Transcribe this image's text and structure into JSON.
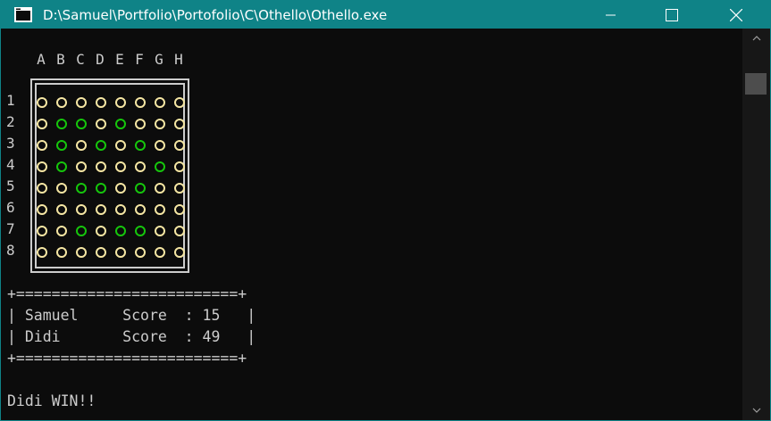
{
  "window": {
    "title": "D:\\Samuel\\Portfolio\\Portofolio\\C\\Othello\\Othello.exe",
    "title_bar_color": "#0f8387",
    "icons": {
      "app": "console-app-icon",
      "minimize": "minimize-icon",
      "maximize": "maximize-icon",
      "close": "close-icon"
    }
  },
  "board": {
    "columns": [
      "A",
      "B",
      "C",
      "D",
      "E",
      "F",
      "G",
      "H"
    ],
    "rows": [
      "1",
      "2",
      "3",
      "4",
      "5",
      "6",
      "7",
      "8"
    ],
    "legend_colors": {
      "Y": "#f5e6a3",
      "G": "#16c60c"
    },
    "grid": [
      [
        "Y",
        "Y",
        "Y",
        "Y",
        "Y",
        "Y",
        "Y",
        "Y"
      ],
      [
        "Y",
        "G",
        "G",
        "Y",
        "G",
        "Y",
        "Y",
        "Y"
      ],
      [
        "Y",
        "G",
        "Y",
        "G",
        "Y",
        "G",
        "Y",
        "Y"
      ],
      [
        "Y",
        "G",
        "Y",
        "Y",
        "Y",
        "Y",
        "G",
        "Y"
      ],
      [
        "Y",
        "Y",
        "G",
        "G",
        "Y",
        "G",
        "Y",
        "Y"
      ],
      [
        "Y",
        "Y",
        "Y",
        "Y",
        "Y",
        "Y",
        "Y",
        "Y"
      ],
      [
        "Y",
        "Y",
        "G",
        "Y",
        "G",
        "G",
        "Y",
        "Y"
      ],
      [
        "Y",
        "Y",
        "Y",
        "Y",
        "Y",
        "Y",
        "Y",
        "Y"
      ]
    ]
  },
  "scoreboard": {
    "border_top": "+=========================+",
    "row1": "| Samuel     Score  : 15   |",
    "row2": "| Didi       Score  : 49   |",
    "border_bottom": "+=========================+"
  },
  "result": "Didi WIN!!",
  "scrollbar": {
    "up_icon": "scroll-up-arrow-icon",
    "down_icon": "scroll-down-arrow-icon"
  }
}
